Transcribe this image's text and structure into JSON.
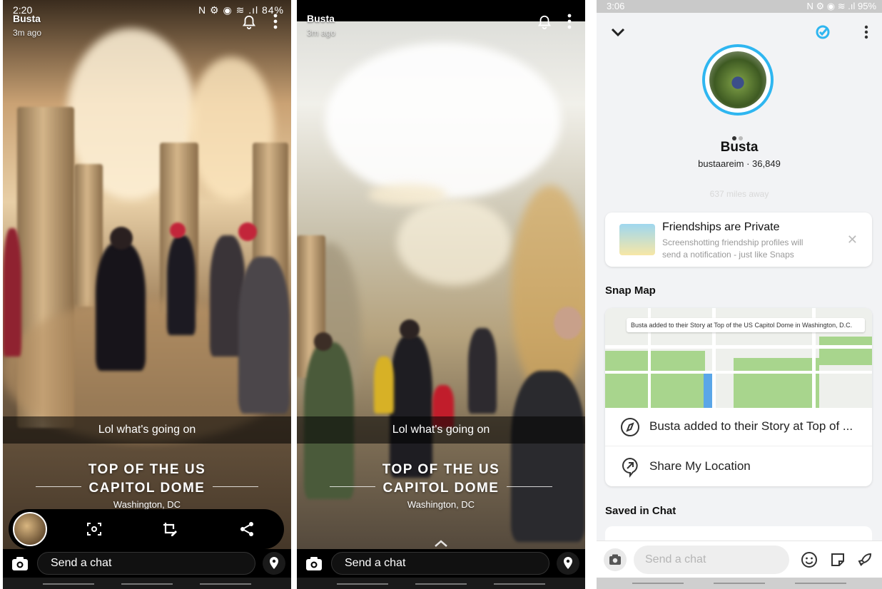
{
  "screen1": {
    "status_time": "2:20",
    "status_icons": "N ⚙ ◉ ≋ .ıl 84%",
    "user": "Busta",
    "time_ago": "3m ago",
    "caption": "Lol what's going on",
    "geofilter_line1": "TOP OF THE US",
    "geofilter_line2": "CAPITOL DOME",
    "geofilter_sub": "Washington, DC",
    "send_placeholder": "Send a chat"
  },
  "screen2": {
    "user": "Busta",
    "time_ago": "3m ago",
    "caption": "Lol what's going on",
    "geofilter_line1": "TOP OF THE US",
    "geofilter_line2": "CAPITOL DOME",
    "geofilter_sub": "Washington, DC",
    "send_placeholder": "Send a chat"
  },
  "profile": {
    "status_time": "3:06",
    "status_icons": "N ⚙ ◉ ≋ .ıl 95%",
    "name": "Busta",
    "username": "bustaareim",
    "score": "36,849",
    "distance": "637 miles away",
    "privacy_title": "Friendships are Private",
    "privacy_desc": "Screenshotting friendship profiles will send a notification - just like Snaps",
    "snap_map_title": "Snap Map",
    "map_banner": "Busta added to their Story at Top of the US Capitol Dome in Washington, D.C.",
    "story_row": "Busta added to their Story at Top of ...",
    "share_row": "Share My Location",
    "saved_title": "Saved in Chat",
    "send_placeholder": "Send a chat"
  },
  "colors": {
    "accent_blue": "#2fb6f0",
    "map_park": "#a8d58d",
    "map_water": "#5aa6e8"
  }
}
